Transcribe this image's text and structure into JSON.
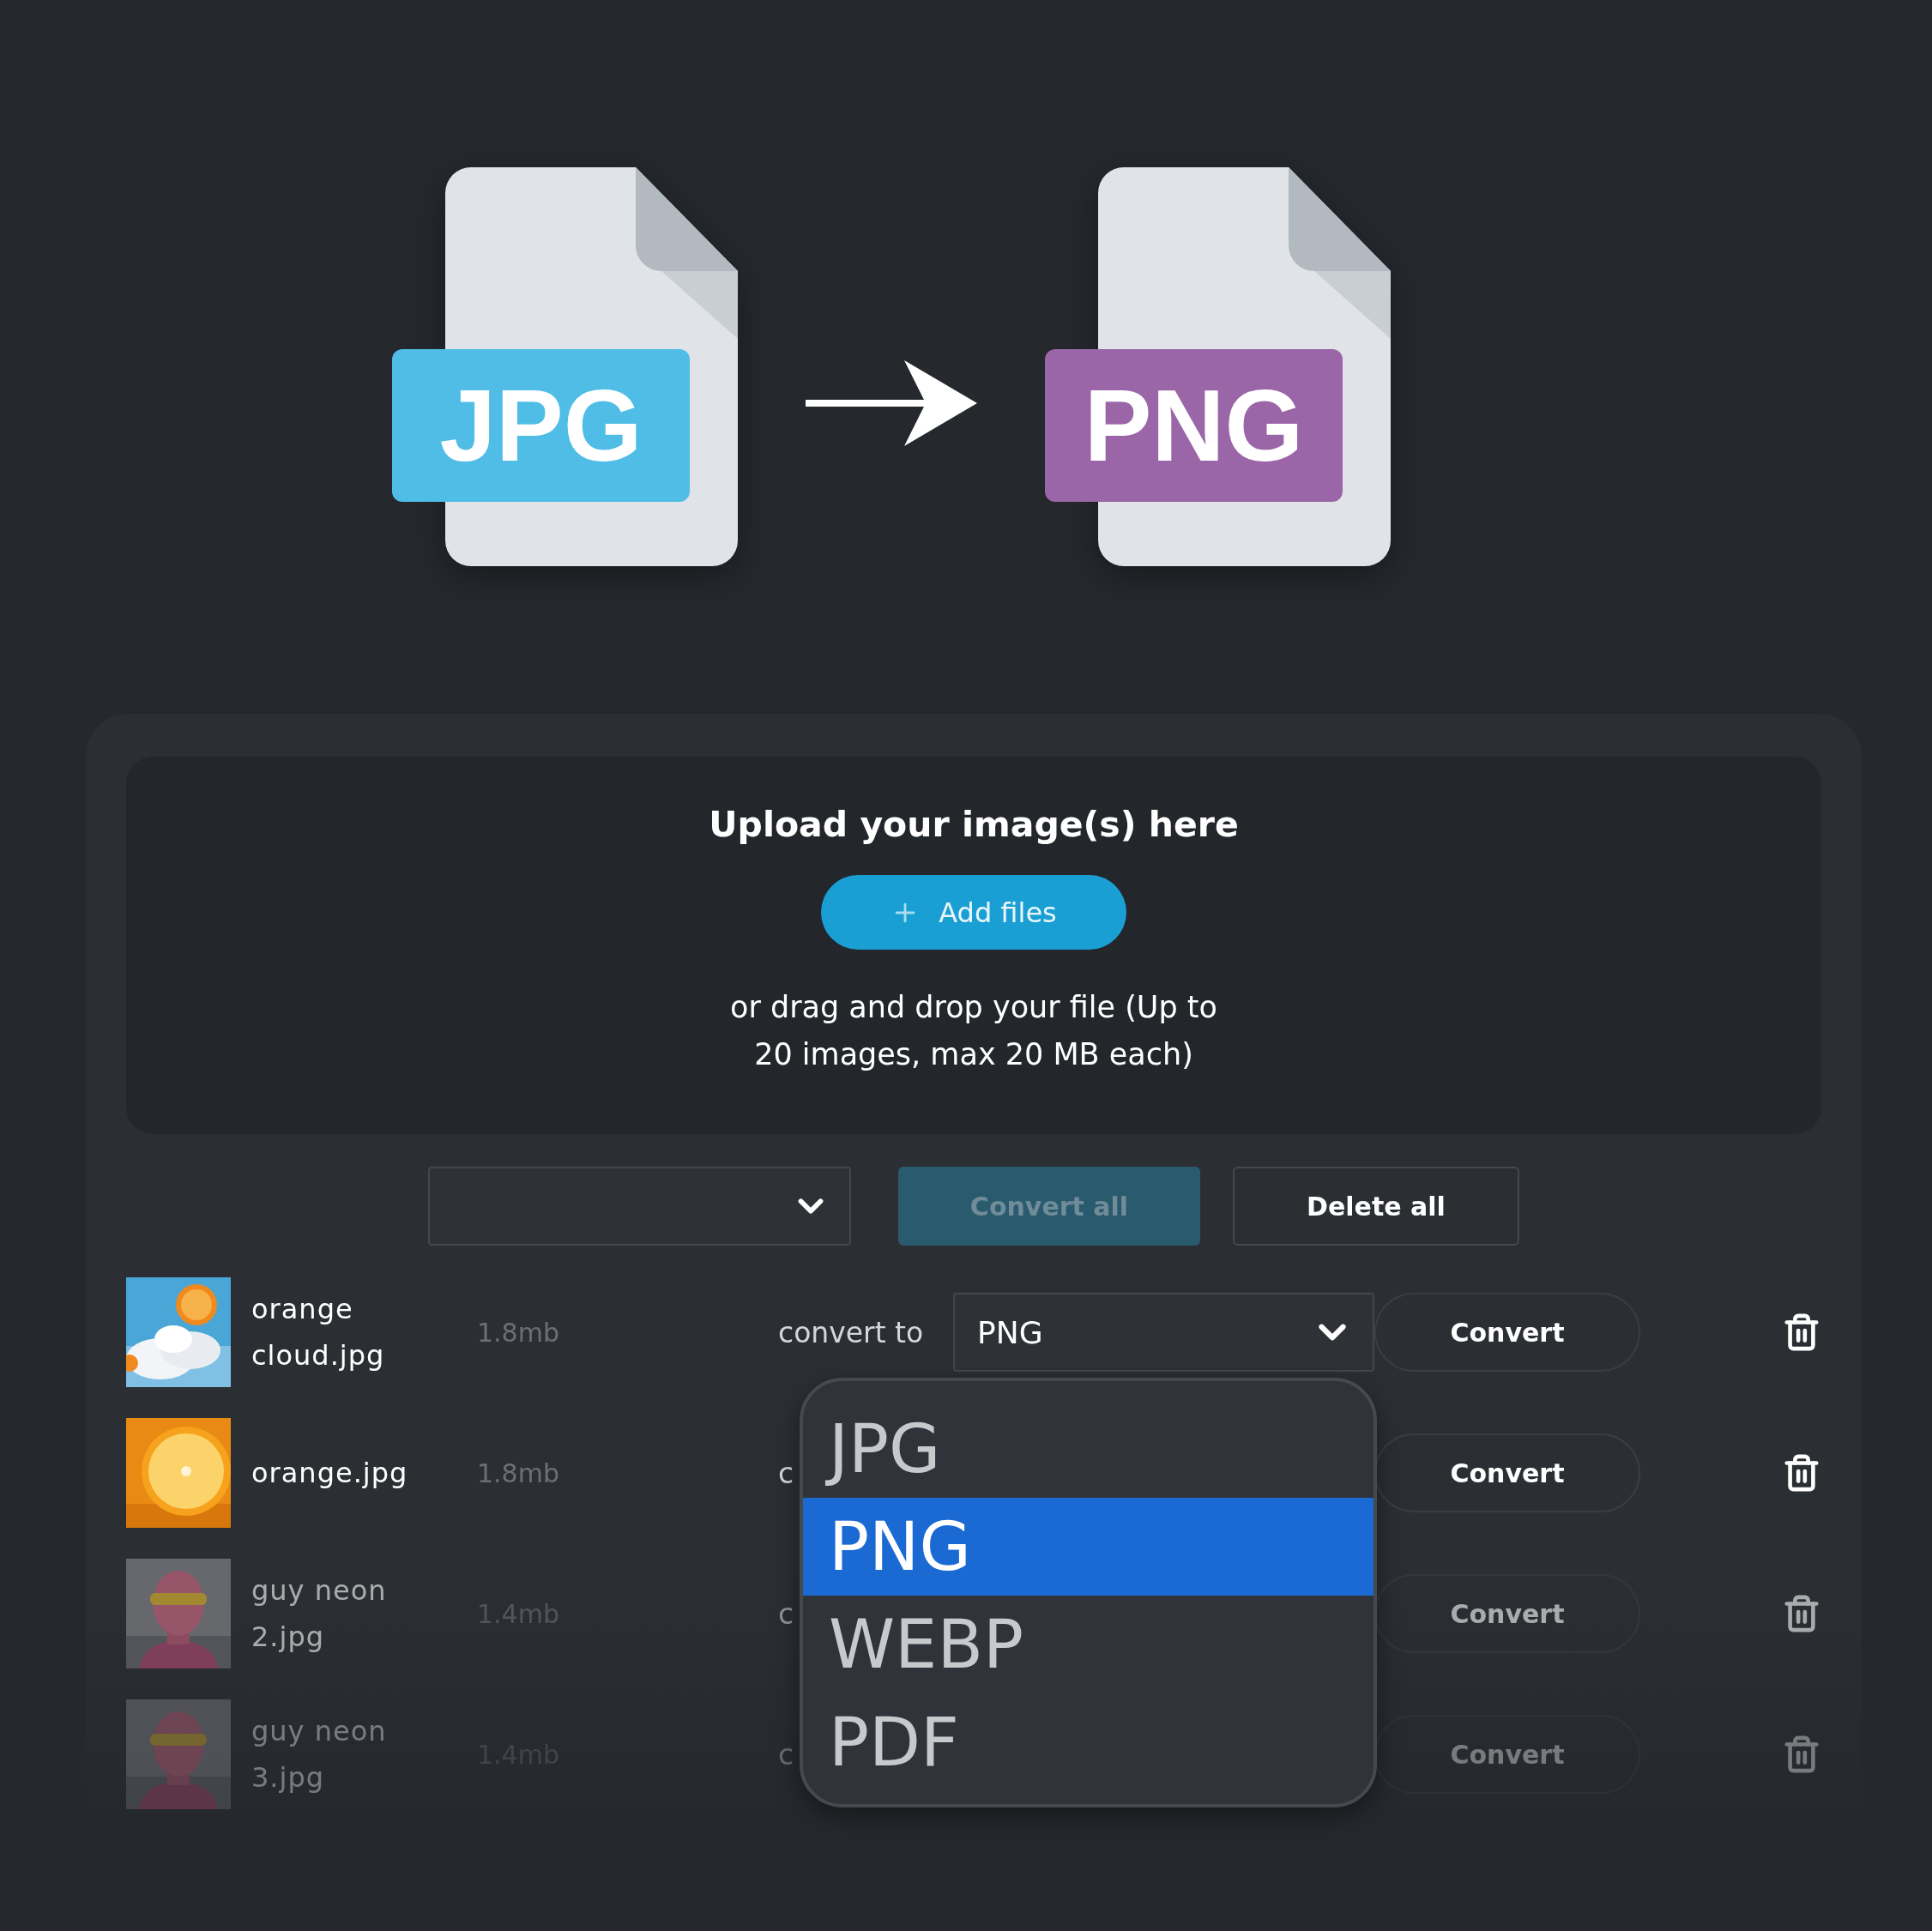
{
  "banner": {
    "formats": [
      {
        "label": "JPG",
        "color": "#4fbde6"
      },
      {
        "label": "PNG",
        "color": "#9b66a8"
      }
    ]
  },
  "upload": {
    "title": "Upload your image(s) here",
    "add_button": "Add files",
    "hint_lines": [
      "or drag and drop your file (Up to",
      "20 images, max 20 MB each)"
    ]
  },
  "toolbar": {
    "convert_all": "Convert all",
    "delete_all": "Delete all"
  },
  "files": [
    {
      "name": "orange cloud.jpg",
      "size": "1.8mb",
      "convert_label": "convert to",
      "format": "PNG",
      "button": "Convert"
    },
    {
      "name": "orange.jpg",
      "size": "1.8mb",
      "convert_label": "c",
      "button": "Convert"
    },
    {
      "name": "guy neon 2.jpg",
      "size": "1.4mb",
      "convert_label": "c",
      "button": "Convert"
    },
    {
      "name": "guy neon 3.jpg",
      "size": "1.4mb",
      "convert_label": "c",
      "button": "Convert"
    }
  ],
  "format_menu": {
    "options": [
      {
        "label": "JPG",
        "selected": false
      },
      {
        "label": "PNG",
        "selected": true
      },
      {
        "label": "WEBP",
        "selected": false
      },
      {
        "label": "PDF",
        "selected": false
      }
    ]
  }
}
